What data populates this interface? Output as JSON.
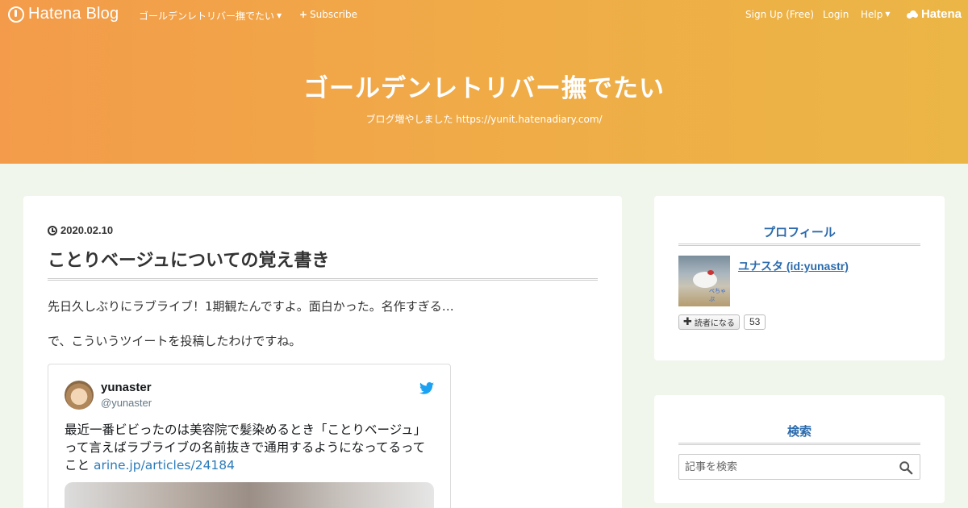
{
  "topbar": {
    "logo_text": "Hatena Blog",
    "blog_menu": "ゴールデンレトリバー撫でたい",
    "subscribe": "Subscribe",
    "signup": "Sign Up (Free)",
    "login": "Login",
    "help": "Help",
    "brand": "Hatena"
  },
  "blog": {
    "title": "ゴールデンレトリバー撫でたい",
    "description": "ブログ増やしました https://yunit.hatenadiary.com/"
  },
  "article": {
    "date": "2020.02.10",
    "title": "ことりベージュについての覚え書き",
    "paragraphs": [
      "先日久しぶりにラブライブ！1期観たんですよ。面白かった。名作すぎる…",
      "で、こういうツイートを投稿したわけですね。"
    ],
    "tweet": {
      "name": "yunaster",
      "handle": "@yunaster",
      "text": "最近一番ビビったのは美容院で髪染めるとき「ことりベージュ」って言えばラブライブの名前抜きで通用するようになってるってこと",
      "link": "arine.jp/articles/24184"
    }
  },
  "sidebar": {
    "profile": {
      "title": "プロフィール",
      "user_name": "ユナスタ (id:yunastr)",
      "image_caption": "ぺちゃぷ",
      "reader_button": "読者になる",
      "reader_count": "53"
    },
    "search": {
      "title": "検索",
      "placeholder": "記事を検索"
    }
  },
  "colors": {
    "header_gradient_start": "#f39b4a",
    "header_gradient_end": "#ebb646",
    "page_background": "#f1f6ec",
    "link_blue": "#2a6aad",
    "twitter_blue": "#1da1f2"
  }
}
